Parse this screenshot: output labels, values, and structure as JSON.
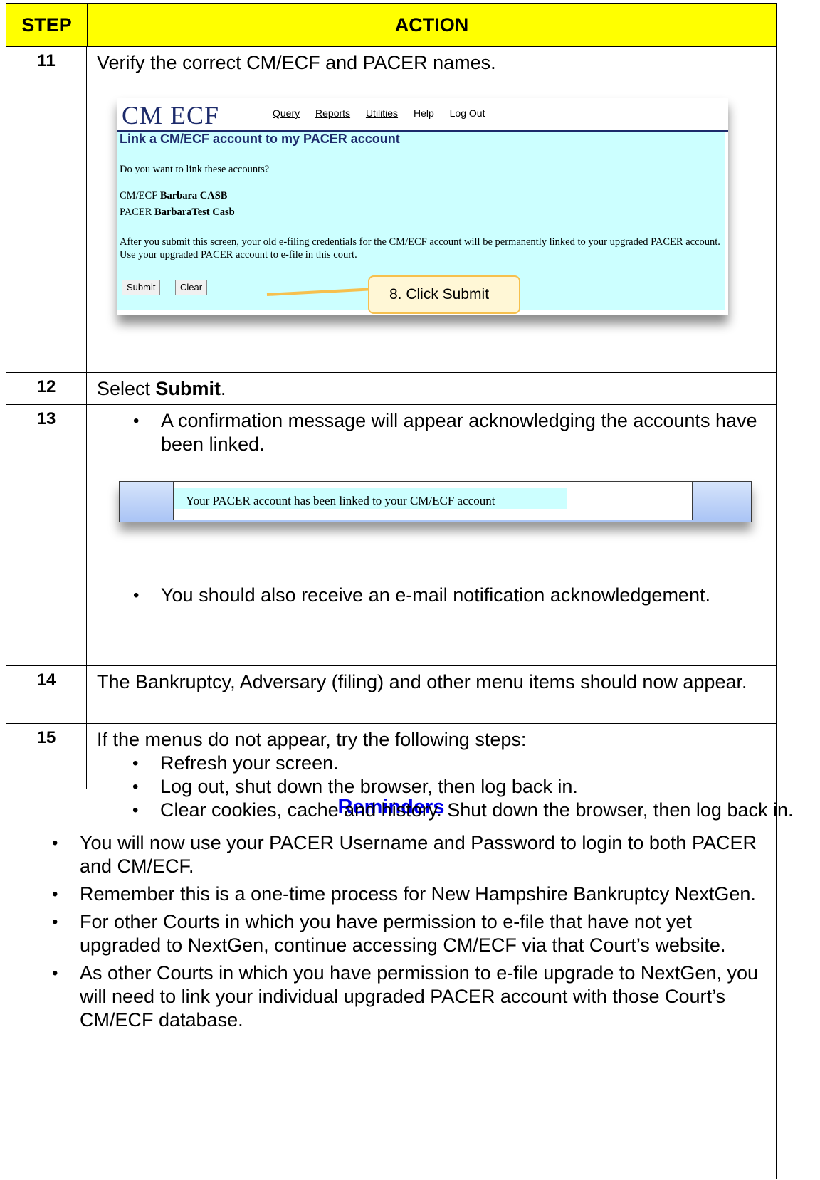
{
  "header": {
    "step": "STEP",
    "action": "ACTION"
  },
  "steps": [
    {
      "num": "11",
      "text": "Verify the correct CM/ECF and PACER names."
    },
    {
      "num": "12",
      "text_pre": "Select ",
      "text_bold": "Submit",
      "text_post": "."
    },
    {
      "num": "13",
      "bullets": [
        "A confirmation message will appear acknowledging the accounts have been linked.",
        "You should also receive an e-mail notification acknowledgement."
      ]
    },
    {
      "num": "14",
      "text": "The Bankruptcy, Adversary (filing) and other menu items should now appear."
    },
    {
      "num": "15",
      "text": "If the menus do not appear, try the following steps:",
      "bullets": [
        "Refresh your screen.",
        "Log out, shut down the browser, then log back in.",
        "Clear cookies, cache and history.  Shut down the browser, then log back in."
      ]
    }
  ],
  "cmecf": {
    "logo": "CM ECF",
    "menu": [
      "Query",
      "Reports",
      "Utilities",
      "Help",
      "Log Out"
    ],
    "title": "Link a CM/ECF account to my PACER account",
    "question": "Do you want to link these accounts?",
    "cmecf_label": "CM/ECF",
    "cmecf_name": "Barbara CASB",
    "pacer_label": "PACER",
    "pacer_name": "BarbaraTest Casb",
    "paragraph": "After you submit this screen, your old e-filing credentials for the CM/ECF account will be permanently linked to your upgraded PACER account. Use your upgraded PACER account to e-file in this court.",
    "submit": "Submit",
    "clear": "Clear",
    "callout": "8. Click Submit"
  },
  "confirmation": "Your PACER account has been linked to your CM/ECF account",
  "reminders": {
    "heading": "Reminders",
    "items": [
      "You will now use your PACER Username and Password to login to both PACER and CM/ECF.",
      "Remember this is a one-time process for New Hampshire Bankruptcy NextGen.",
      "For other Courts in which you have permission to e-file that have not yet upgraded to NextGen, continue accessing CM/ECF via that Court’s website.",
      "As other Courts in which you have permission to e-file upgrade to NextGen, you will need to link your individual upgraded PACER account with those Court’s CM/ECF database."
    ]
  },
  "colors": {
    "header_bg": "#ffff00",
    "reminder_heading": "#0000ee",
    "cmecf_bg": "#ccffff",
    "callout_border": "#f6c04e"
  }
}
